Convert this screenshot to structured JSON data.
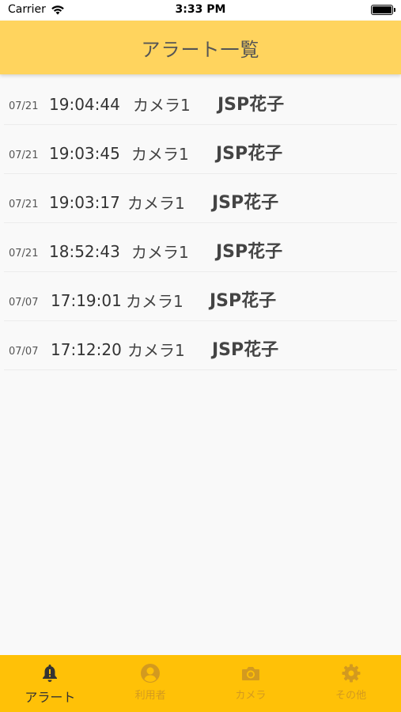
{
  "status_bar": {
    "carrier": "Carrier",
    "time": "3:33 PM"
  },
  "header": {
    "title": "アラート一覧"
  },
  "alerts": [
    {
      "date": "07/21",
      "time": "19:04:44",
      "camera": "カメラ1",
      "user": "JSP花子"
    },
    {
      "date": "07/21",
      "time": "19:03:45",
      "camera": "カメラ1",
      "user": "JSP花子"
    },
    {
      "date": "07/21",
      "time": "19:03:17",
      "camera": "カメラ1",
      "user": "JSP花子"
    },
    {
      "date": "07/21",
      "time": "18:52:43",
      "camera": "カメラ1",
      "user": "JSP花子"
    },
    {
      "date": "07/07",
      "time": "17:19:01",
      "camera": "カメラ1",
      "user": "JSP花子"
    },
    {
      "date": "07/07",
      "time": "17:12:20",
      "camera": "カメラ1",
      "user": "JSP花子"
    }
  ],
  "tabs": [
    {
      "label": "アラート",
      "icon": "bell-alert-icon",
      "active": true
    },
    {
      "label": "利用者",
      "icon": "user-circle-icon",
      "active": false
    },
    {
      "label": "カメラ",
      "icon": "camera-icon",
      "active": false
    },
    {
      "label": "その他",
      "icon": "gear-icon",
      "active": false
    }
  ],
  "colors": {
    "header_bg": "#ffd45e",
    "tab_bar_bg": "#ffc107",
    "tab_active": "#333333",
    "tab_inactive": "#d39a1f"
  }
}
